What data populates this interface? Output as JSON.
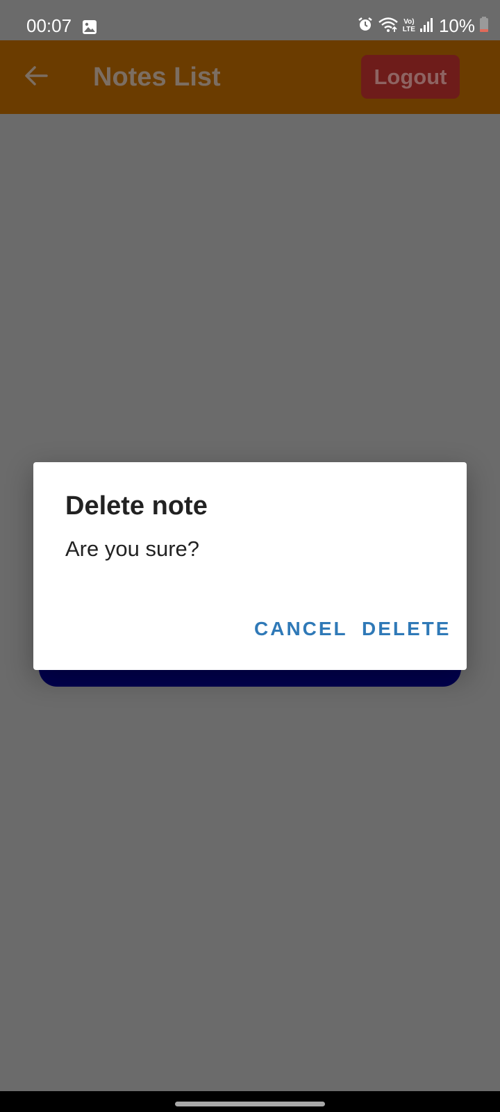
{
  "status_bar": {
    "time": "00:07",
    "battery": "10%",
    "icons": [
      "image-icon",
      "alarm-icon",
      "wifi-icon",
      "volte-icon",
      "signal-icon",
      "battery-icon"
    ],
    "volte_label_top": "Vo)",
    "volte_label_bottom": "LTE"
  },
  "app_bar": {
    "title": "Notes List",
    "back_icon": "arrow-left-icon",
    "logout_label": "Logout",
    "background_color": "#6b3c00",
    "logout_color": "#6e1c1a"
  },
  "dialog": {
    "title": "Delete note",
    "message": "Are you sure?",
    "cancel_label": "CANCEL",
    "delete_label": "DELETE",
    "button_color": "#2f79b7"
  },
  "colors": {
    "scrim": "#6b6b6b",
    "note_card": "#00004f"
  }
}
